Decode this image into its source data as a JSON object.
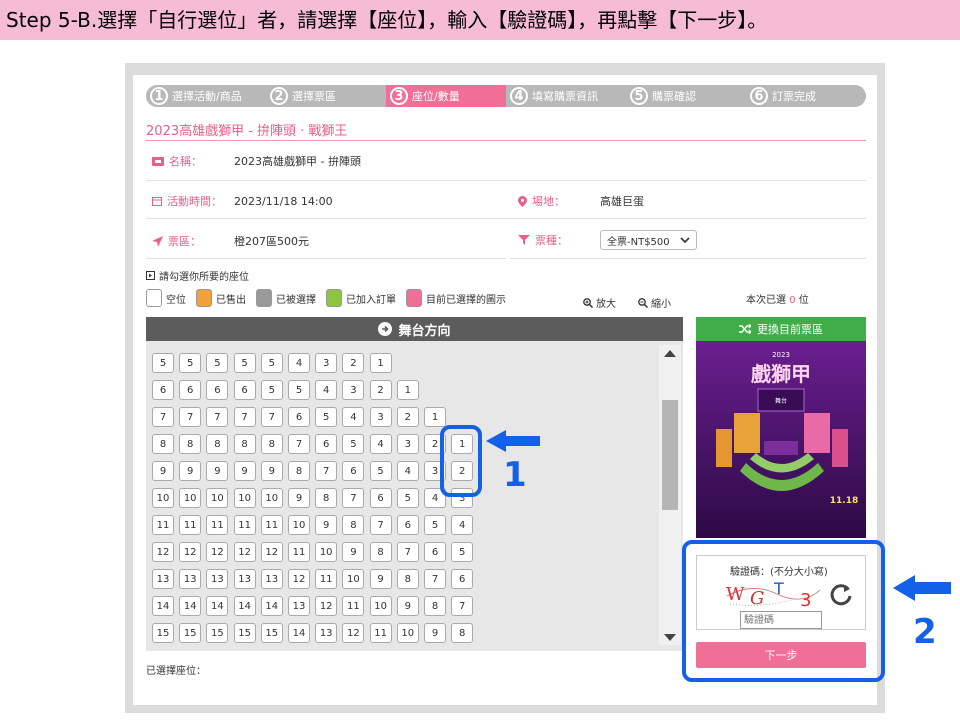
{
  "instruction": "Step 5-B.選擇「自行選位」者，請選擇【座位】，輸入【驗證碼】，再點擊【下一步】。",
  "steps": [
    {
      "num": "1",
      "label": "選擇活動/商品",
      "active": false
    },
    {
      "num": "2",
      "label": "選擇票區",
      "active": false
    },
    {
      "num": "3",
      "label": "座位/數量",
      "active": true
    },
    {
      "num": "4",
      "label": "填寫購票資訊",
      "active": false
    },
    {
      "num": "5",
      "label": "購票確認",
      "active": false
    },
    {
      "num": "6",
      "label": "訂票完成",
      "active": false
    }
  ],
  "event_title": "2023高雄戲獅甲 - 拚陣頭 · 戰獅王",
  "info": {
    "name_label": "名稱：",
    "name_value": "2023高雄戲獅甲 - 拚陣頭",
    "time_label": "活動時間：",
    "time_value": "2023/11/18  14:00",
    "venue_label": "場地：",
    "venue_value": "高雄巨蛋",
    "area_label": "票區：",
    "area_value": "橙207區500元",
    "ticket_type_label": "票種：",
    "ticket_type_value": "全票-NT$500"
  },
  "hint_text": "請勾選你所要的座位",
  "legend": [
    {
      "label": "空位",
      "color": "#ffffff"
    },
    {
      "label": "已售出",
      "color": "#f2a13a"
    },
    {
      "label": "已被選擇",
      "color": "#9a9a9a"
    },
    {
      "label": "已加入訂單",
      "color": "#8cc63f"
    },
    {
      "label": "目前已選擇的圖示",
      "color": "#ef6f97"
    }
  ],
  "zoom_in": "放大",
  "zoom_out": "縮小",
  "selected_count": {
    "prefix": "本次已選",
    "count": "0",
    "suffix": "位"
  },
  "stage_label": "舞台方向",
  "seat_rows": [
    [
      "5",
      "5",
      "5",
      "5",
      "5",
      "4",
      "3",
      "2",
      "1"
    ],
    [
      "6",
      "6",
      "6",
      "6",
      "5",
      "5",
      "4",
      "3",
      "2",
      "1"
    ],
    [
      "7",
      "7",
      "7",
      "7",
      "7",
      "6",
      "5",
      "4",
      "3",
      "2",
      "1"
    ],
    [
      "8",
      "8",
      "8",
      "8",
      "8",
      "7",
      "6",
      "5",
      "4",
      "3",
      "2",
      "1"
    ],
    [
      "9",
      "9",
      "9",
      "9",
      "9",
      "8",
      "7",
      "6",
      "5",
      "4",
      "3",
      "2"
    ],
    [
      "10",
      "10",
      "10",
      "10",
      "10",
      "9",
      "8",
      "7",
      "6",
      "5",
      "4",
      "3"
    ],
    [
      "11",
      "11",
      "11",
      "11",
      "11",
      "10",
      "9",
      "8",
      "7",
      "6",
      "5",
      "4"
    ],
    [
      "12",
      "12",
      "12",
      "12",
      "12",
      "11",
      "10",
      "9",
      "8",
      "7",
      "6",
      "5"
    ],
    [
      "13",
      "13",
      "13",
      "13",
      "13",
      "12",
      "11",
      "10",
      "9",
      "8",
      "7",
      "6"
    ],
    [
      "14",
      "14",
      "14",
      "14",
      "14",
      "13",
      "12",
      "11",
      "10",
      "9",
      "8",
      "7"
    ],
    [
      "15",
      "15",
      "15",
      "15",
      "15",
      "14",
      "13",
      "12",
      "11",
      "10",
      "9",
      "8"
    ]
  ],
  "selected_seats_label": "已選擇座位：",
  "change_area_button": "更換目前票區",
  "poster": {
    "year": "2023",
    "title": "戲獅甲",
    "stage": "舞台",
    "date": "11.18"
  },
  "captcha": {
    "title": "驗證碼：(不分大小寫)",
    "chars": [
      "W",
      "G",
      "T",
      "3"
    ],
    "placeholder": "驗證碼"
  },
  "next_button": "下一步",
  "annotations": {
    "one": "1",
    "two": "2"
  },
  "colors": {
    "accent": "#ef6f97",
    "annotation": "#1560e8",
    "green": "#3fae49"
  }
}
